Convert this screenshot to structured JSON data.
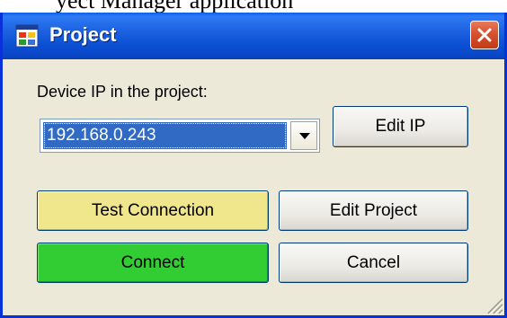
{
  "background_fragment": "yect Manager application",
  "window": {
    "title": "Project",
    "close_icon": "close-icon"
  },
  "form": {
    "device_ip_label": "Device IP in the project:",
    "device_ip_value": "192.168.0.243"
  },
  "buttons": {
    "edit_ip": "Edit IP",
    "test_connection": "Test Connection",
    "edit_project": "Edit Project",
    "connect": "Connect",
    "cancel": "Cancel"
  },
  "colors": {
    "titlebar": "#0a4fd3",
    "selection": "#316ac5",
    "test_connection_bg": "#f0e68c",
    "connect_bg": "#32cd32",
    "close_bg": "#d6522f"
  }
}
